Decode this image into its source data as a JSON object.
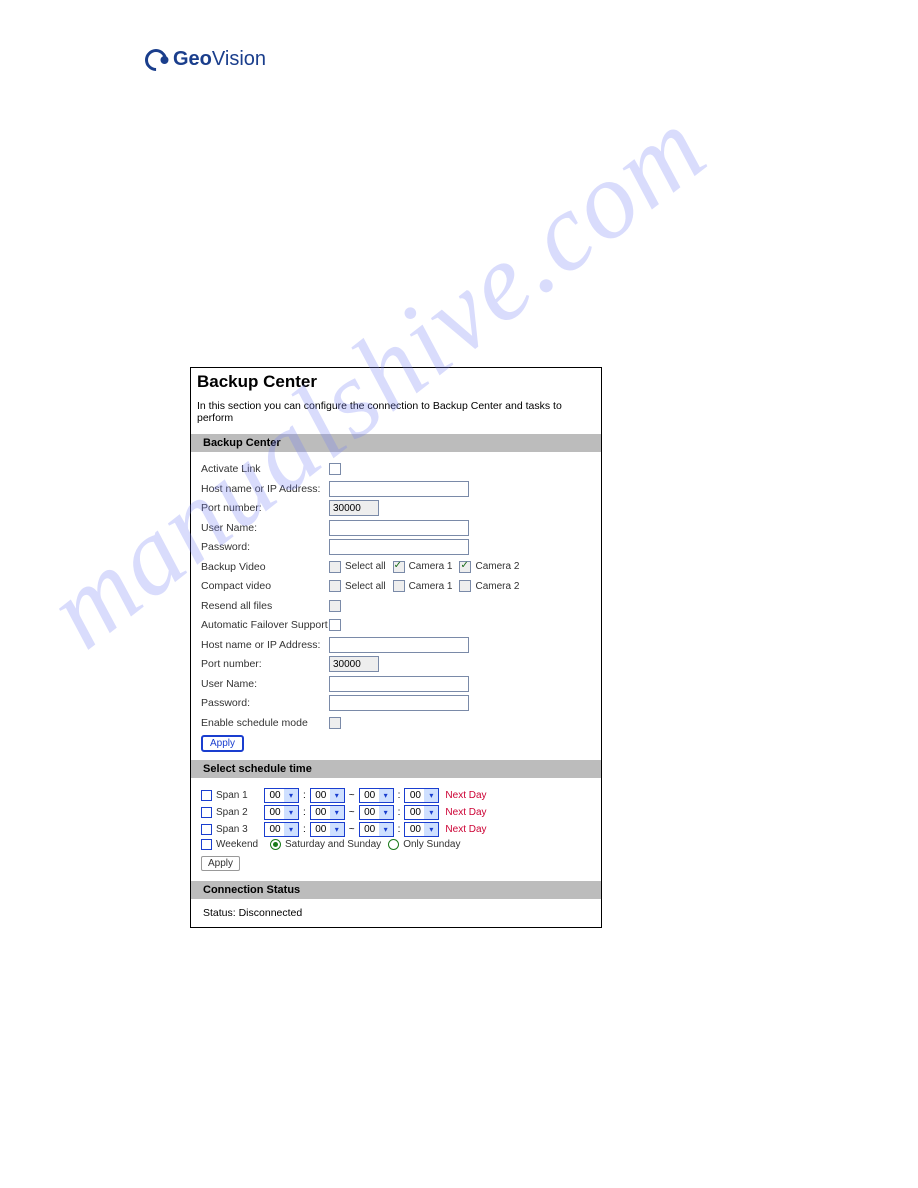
{
  "brand": {
    "left": "Geo",
    "right": "Vision"
  },
  "watermark": "manualshive.com",
  "panel": {
    "title": "Backup Center",
    "description": "In this section you can configure the connection to Backup Center and tasks to perform"
  },
  "s1": {
    "header": "Backup Center",
    "activate_link": "Activate Link",
    "host1": "Host name or IP Address:",
    "port1": "Port number:",
    "port1_val": "30000",
    "user1": "User Name:",
    "pass1": "Password:",
    "backup_video": "Backup Video",
    "compact_video": "Compact video",
    "select_all": "Select all",
    "cam1": "Camera 1",
    "cam2": "Camera 2",
    "resend": "Resend all files",
    "failover": "Automatic Failover Support",
    "host2": "Host name or IP Address:",
    "port2": "Port number:",
    "port2_val": "30000",
    "user2": "User Name:",
    "pass2": "Password:",
    "enable_sched": "Enable schedule mode",
    "apply": "Apply"
  },
  "s2": {
    "header": "Select schedule time",
    "span1": "Span 1",
    "span2": "Span 2",
    "span3": "Span 3",
    "weekend": "Weekend",
    "dd": "00",
    "nextday": "Next Day",
    "opt1": "Saturday and Sunday",
    "opt2": "Only Sunday",
    "apply": "Apply"
  },
  "s3": {
    "header": "Connection Status",
    "status": "Status: Disconnected"
  }
}
